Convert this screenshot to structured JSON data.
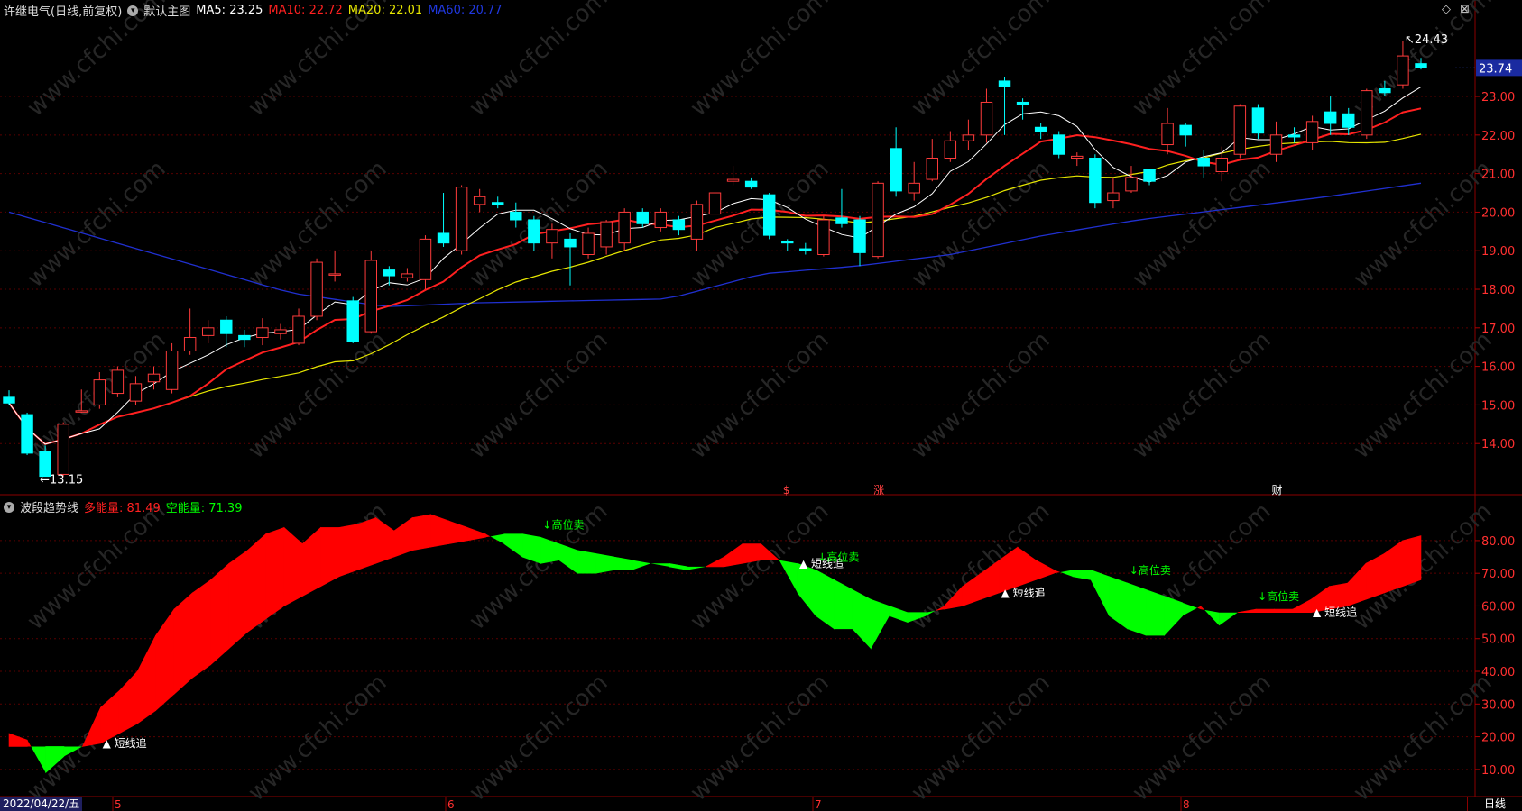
{
  "header": {
    "stock": "许继电气(日线,前复权)",
    "template": "默认主图",
    "ma5": "MA5: 23.25",
    "ma10": "MA10: 22.72",
    "ma20": "MA20: 22.01",
    "ma60": "MA60: 20.77"
  },
  "indicator_header": {
    "name": "波段趋势线",
    "bull": "多能量: 81.49",
    "bear": "空能量: 71.39"
  },
  "colors": {
    "up": "#ff3b3b",
    "down": "#00ffff",
    "ma5": "#ffffff",
    "ma10": "#ff2020",
    "ma20": "#e6e600",
    "ma60": "#2030d0",
    "bull": "#ff0000",
    "bear": "#00ff00"
  },
  "price_axis": [
    "23.00",
    "22.00",
    "21.00",
    "20.00",
    "19.00",
    "18.00",
    "17.00",
    "16.00",
    "15.00",
    "14.00"
  ],
  "last_price": "23.74",
  "max_label": "24.43",
  "min_label": "13.15",
  "indicator_axis": [
    "80.00",
    "70.00",
    "60.00",
    "50.00",
    "40.00",
    "30.00",
    "20.00",
    "10.00"
  ],
  "x_labels": [
    "2022/04/22/五",
    "5",
    "6",
    "7",
    "8"
  ],
  "period": "日线",
  "events": [
    "$",
    "涨",
    "财"
  ],
  "watermark": "www.cfchi.com",
  "signals": [
    {
      "text": "短线追",
      "i": 5
    },
    {
      "text": "短线追",
      "i": 43
    },
    {
      "text": "↓高位卖",
      "i": 44
    },
    {
      "text": "短线追",
      "i": 54
    },
    {
      "text": "↓高位卖",
      "i": 61
    },
    {
      "text": "↓高位卖",
      "i": 68
    },
    {
      "text": "短线追",
      "i": 71
    },
    {
      "text": "↓高位卖",
      "i": 29
    }
  ],
  "chart_data": {
    "type": "candlestick",
    "title": "许继电气(日线,前复权)",
    "ylim": [
      13.0,
      24.8
    ],
    "candles": [
      [
        15.2,
        15.05,
        15.38,
        15.0
      ],
      [
        14.75,
        13.75,
        14.8,
        13.7
      ],
      [
        13.8,
        13.15,
        13.95,
        13.15
      ],
      [
        13.2,
        14.5,
        14.55,
        13.15
      ],
      [
        14.85,
        14.85,
        15.4,
        14.8
      ],
      [
        15.0,
        15.65,
        15.85,
        14.9
      ],
      [
        15.3,
        15.9,
        16.0,
        15.2
      ],
      [
        15.1,
        15.55,
        15.75,
        15.0
      ],
      [
        15.6,
        15.8,
        16.0,
        15.4
      ],
      [
        15.4,
        16.4,
        16.6,
        15.3
      ],
      [
        16.4,
        16.75,
        17.5,
        16.3
      ],
      [
        16.8,
        17.0,
        17.2,
        16.6
      ],
      [
        17.2,
        16.85,
        17.3,
        16.5
      ],
      [
        16.8,
        16.7,
        16.95,
        16.5
      ],
      [
        16.75,
        17.0,
        17.25,
        16.55
      ],
      [
        16.85,
        16.95,
        17.1,
        16.7
      ],
      [
        16.6,
        17.3,
        17.5,
        16.55
      ],
      [
        17.3,
        18.7,
        18.8,
        17.2
      ],
      [
        18.4,
        18.4,
        19.0,
        18.2
      ],
      [
        17.7,
        16.65,
        17.8,
        16.6
      ],
      [
        16.9,
        18.75,
        19.0,
        16.85
      ],
      [
        18.5,
        18.35,
        18.6,
        18.1
      ],
      [
        18.3,
        18.4,
        18.55,
        18.2
      ],
      [
        18.25,
        19.3,
        19.4,
        18.0
      ],
      [
        19.45,
        19.2,
        20.5,
        19.1
      ],
      [
        19.0,
        20.65,
        20.7,
        18.9
      ],
      [
        20.2,
        20.4,
        20.6,
        20.0
      ],
      [
        20.25,
        20.2,
        20.4,
        20.1
      ],
      [
        20.0,
        19.8,
        20.25,
        19.6
      ],
      [
        19.8,
        19.2,
        19.9,
        19.0
      ],
      [
        19.2,
        19.55,
        19.7,
        18.8
      ],
      [
        19.3,
        19.1,
        19.45,
        18.1
      ],
      [
        18.9,
        19.45,
        19.6,
        18.8
      ],
      [
        19.1,
        19.75,
        19.8,
        18.9
      ],
      [
        19.2,
        20.0,
        20.1,
        19.0
      ],
      [
        20.0,
        19.7,
        20.1,
        19.6
      ],
      [
        19.6,
        20.0,
        20.1,
        19.5
      ],
      [
        19.8,
        19.55,
        19.9,
        19.4
      ],
      [
        19.3,
        20.2,
        20.3,
        19.0
      ],
      [
        19.95,
        20.5,
        20.6,
        19.9
      ],
      [
        20.8,
        20.85,
        21.2,
        20.7
      ],
      [
        20.8,
        20.65,
        20.9,
        20.6
      ],
      [
        20.45,
        19.4,
        20.5,
        19.3
      ],
      [
        19.25,
        19.2,
        19.3,
        19.0
      ],
      [
        19.05,
        19.0,
        19.2,
        18.9
      ],
      [
        18.9,
        19.8,
        19.9,
        18.85
      ],
      [
        19.85,
        19.7,
        20.6,
        19.6
      ],
      [
        19.8,
        18.95,
        19.9,
        18.6
      ],
      [
        18.85,
        20.75,
        20.8,
        18.8
      ],
      [
        21.65,
        20.55,
        22.2,
        20.4
      ],
      [
        20.5,
        20.75,
        21.3,
        20.3
      ],
      [
        20.85,
        21.4,
        21.9,
        20.8
      ],
      [
        21.4,
        21.85,
        22.1,
        21.3
      ],
      [
        21.85,
        22.0,
        22.4,
        21.6
      ],
      [
        22.0,
        22.85,
        23.2,
        21.8
      ],
      [
        23.4,
        23.25,
        23.5,
        22.0
      ],
      [
        22.85,
        22.8,
        22.95,
        22.4
      ],
      [
        22.2,
        22.1,
        22.3,
        21.9
      ],
      [
        22.0,
        21.5,
        22.1,
        21.4
      ],
      [
        21.4,
        21.45,
        21.55,
        21.2
      ],
      [
        21.4,
        20.25,
        21.5,
        20.1
      ],
      [
        20.3,
        20.5,
        20.9,
        20.1
      ],
      [
        20.55,
        20.9,
        21.2,
        20.5
      ],
      [
        21.1,
        20.8,
        21.1,
        20.7
      ],
      [
        21.75,
        22.3,
        22.7,
        21.5
      ],
      [
        22.25,
        22.0,
        22.3,
        21.7
      ],
      [
        21.4,
        21.2,
        21.6,
        20.9
      ],
      [
        21.05,
        21.4,
        21.7,
        20.8
      ],
      [
        21.5,
        22.75,
        22.8,
        21.4
      ],
      [
        22.7,
        22.05,
        22.8,
        21.9
      ],
      [
        21.5,
        22.0,
        22.35,
        21.3
      ],
      [
        22.0,
        21.95,
        22.2,
        21.8
      ],
      [
        21.8,
        22.35,
        22.5,
        21.6
      ],
      [
        22.6,
        22.3,
        23.0,
        22.0
      ],
      [
        22.55,
        22.2,
        22.7,
        22.0
      ],
      [
        22.0,
        23.15,
        23.2,
        21.9
      ],
      [
        23.2,
        23.1,
        23.4,
        23.0
      ],
      [
        23.3,
        24.05,
        24.43,
        23.2
      ],
      [
        23.85,
        23.74,
        24.0,
        23.7
      ]
    ],
    "ma60": [
      20.0,
      19.3,
      18.6,
      17.9,
      17.55,
      17.65,
      17.7,
      17.75,
      18.4,
      18.6,
      18.9,
      19.4,
      19.8,
      20.1,
      20.4,
      20.75
    ],
    "indicator": {
      "ylim": [
        5,
        91
      ],
      "fast": [
        21,
        19,
        9,
        14,
        17,
        29,
        34,
        40,
        51,
        59,
        64,
        68,
        73,
        77,
        82,
        84,
        79,
        84,
        84,
        85,
        87,
        83,
        87,
        88,
        86,
        84,
        82,
        79,
        75,
        73,
        74,
        70,
        70,
        71,
        71,
        73,
        72,
        71,
        72,
        75,
        79,
        79,
        74,
        64,
        57,
        53,
        53,
        47,
        57,
        55,
        57,
        60,
        66,
        70,
        74,
        78,
        74,
        71,
        69,
        68,
        57,
        53,
        51,
        51,
        57,
        60,
        54,
        58,
        59,
        59,
        59,
        62,
        66,
        67,
        73,
        76,
        80,
        81.5
      ],
      "slow": [
        17,
        17,
        17,
        17,
        17,
        18,
        21,
        24,
        28,
        33,
        38,
        42,
        47,
        52,
        56,
        60,
        63,
        66,
        69,
        71,
        73,
        75,
        77,
        78,
        79,
        80,
        81,
        82,
        82,
        81,
        79,
        77,
        76,
        75,
        74,
        73,
        73,
        72,
        72,
        72,
        73,
        74,
        74,
        73,
        71,
        68,
        65,
        62,
        60,
        58,
        58,
        59,
        60,
        62,
        64,
        66,
        68,
        70,
        71,
        71,
        69,
        67,
        65,
        63,
        61,
        59,
        58,
        58,
        58,
        58,
        58,
        58,
        59,
        60,
        62,
        64,
        66,
        68,
        71.4
      ]
    }
  }
}
